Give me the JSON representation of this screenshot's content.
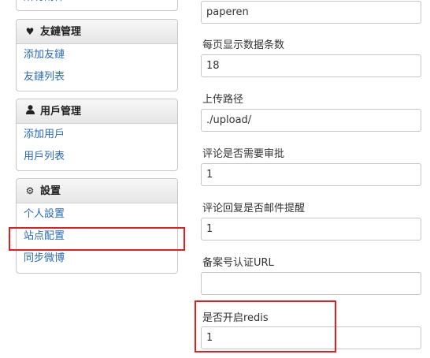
{
  "sidebar": {
    "top_panel": {
      "items": [
        {
          "label": "所有附件"
        }
      ]
    },
    "links_panel": {
      "title": "友鏈管理",
      "items": [
        {
          "label": "添加友鏈"
        },
        {
          "label": "友鏈列表"
        }
      ]
    },
    "users_panel": {
      "title": "用戶管理",
      "items": [
        {
          "label": "添加用戶"
        },
        {
          "label": "用戶列表"
        }
      ]
    },
    "settings_panel": {
      "title": "設置",
      "items": [
        {
          "label": "个人設置"
        },
        {
          "label": "站点配置"
        },
        {
          "label": "同步微博"
        }
      ]
    }
  },
  "form": {
    "fields": [
      {
        "label": "",
        "value": "paperen"
      },
      {
        "label": "每页显示数据条数",
        "value": "18"
      },
      {
        "label": "上传路径",
        "value": "./upload/"
      },
      {
        "label": "评论是否需要审批",
        "value": "1"
      },
      {
        "label": "评论回复是否邮件提醒",
        "value": "1"
      },
      {
        "label": "备案号认证URL",
        "value": ""
      },
      {
        "label": "是否开启redis",
        "value": "1"
      }
    ]
  },
  "colors": {
    "link": "#2a6bb5",
    "highlight": "#e02020"
  },
  "icons": {
    "links_panel": "heart-icon",
    "users_panel": "user-icon",
    "settings_panel": "gear-icon"
  }
}
